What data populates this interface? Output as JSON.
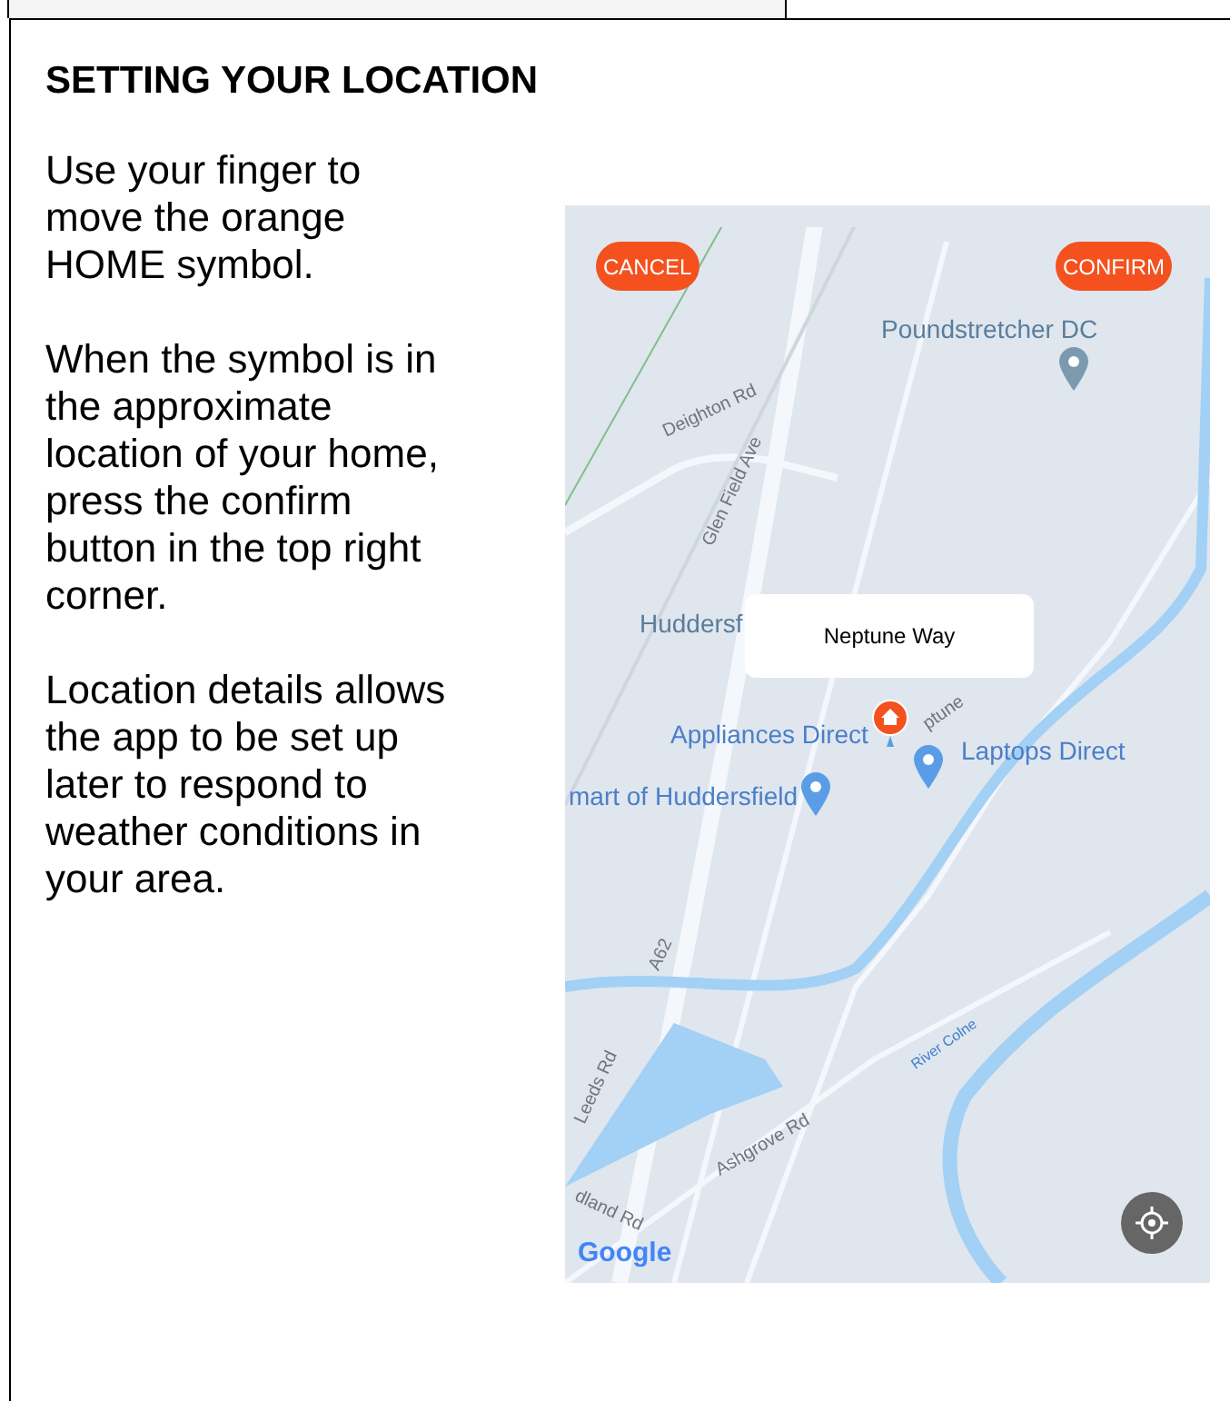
{
  "heading": "SETTING YOUR LOCATION",
  "paragraphs": [
    "Use your finger to move the orange HOME symbol.",
    "When the symbol is in the approximate location of your home, press the confirm button in the top right corner.",
    "Location details allows the app to be set up later to respond to weather conditions in your area."
  ],
  "map": {
    "cancel_button": "CANCEL",
    "confirm_button": "CONFIRM",
    "popup": "Neptune Way",
    "logo": "Google",
    "labels": [
      {
        "text": "Poundstretcher DC",
        "kind": "place"
      },
      {
        "text": "Deighton Rd",
        "kind": "road"
      },
      {
        "text": "Glen Field Ave",
        "kind": "road"
      },
      {
        "text": "Huddersf",
        "kind": "place"
      },
      {
        "text": "ptune",
        "kind": "road"
      },
      {
        "text": "Appliances Direct",
        "kind": "shop"
      },
      {
        "text": "Laptops Direct",
        "kind": "shop"
      },
      {
        "text": "mart of Huddersfield",
        "kind": "shop"
      },
      {
        "text": "A62",
        "kind": "road"
      },
      {
        "text": "Leeds Rd",
        "kind": "road"
      },
      {
        "text": "Ashgrove Rd",
        "kind": "road"
      },
      {
        "text": "River Colne",
        "kind": "water"
      },
      {
        "text": "dland Rd",
        "kind": "road"
      }
    ]
  }
}
